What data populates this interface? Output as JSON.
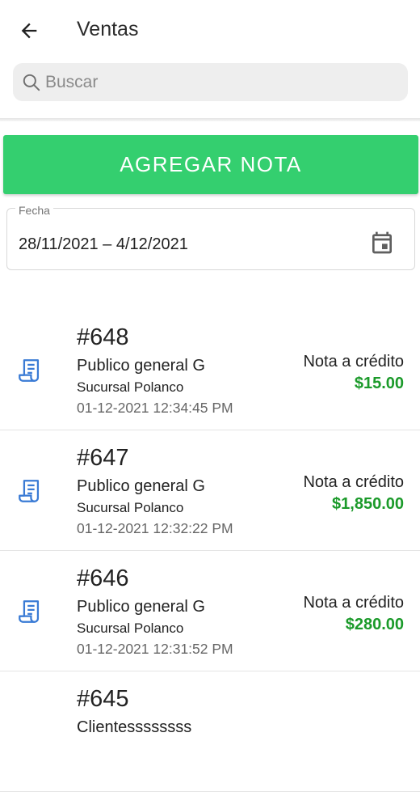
{
  "header": {
    "title": "Ventas"
  },
  "search": {
    "placeholder": "Buscar",
    "value": ""
  },
  "actions": {
    "add_label": "AGREGAR NOTA"
  },
  "date_filter": {
    "label": "Fecha",
    "value": "28/11/2021 – 4/12/2021"
  },
  "colors": {
    "accent": "#34cf6f",
    "amount": "#1b9a2a",
    "icon": "#3a7bd5"
  },
  "icons": {
    "back": "arrow-left-icon",
    "search": "search-icon",
    "calendar": "calendar-icon",
    "row": "receipt-icon"
  },
  "sales": [
    {
      "number": "#648",
      "client": "Publico general G",
      "branch": "Sucursal Polanco",
      "datetime": "01-12-2021 12:34:45 PM",
      "type": "Nota a crédito",
      "amount": "$15.00"
    },
    {
      "number": "#647",
      "client": "Publico general G",
      "branch": "Sucursal Polanco",
      "datetime": "01-12-2021 12:32:22 PM",
      "type": "Nota a crédito",
      "amount": "$1,850.00"
    },
    {
      "number": "#646",
      "client": "Publico general G",
      "branch": "Sucursal Polanco",
      "datetime": "01-12-2021 12:31:52 PM",
      "type": "Nota a crédito",
      "amount": "$280.00"
    },
    {
      "number": "#645",
      "client": "Clientessssssss",
      "branch": "",
      "datetime": "",
      "type": "",
      "amount": ""
    }
  ]
}
